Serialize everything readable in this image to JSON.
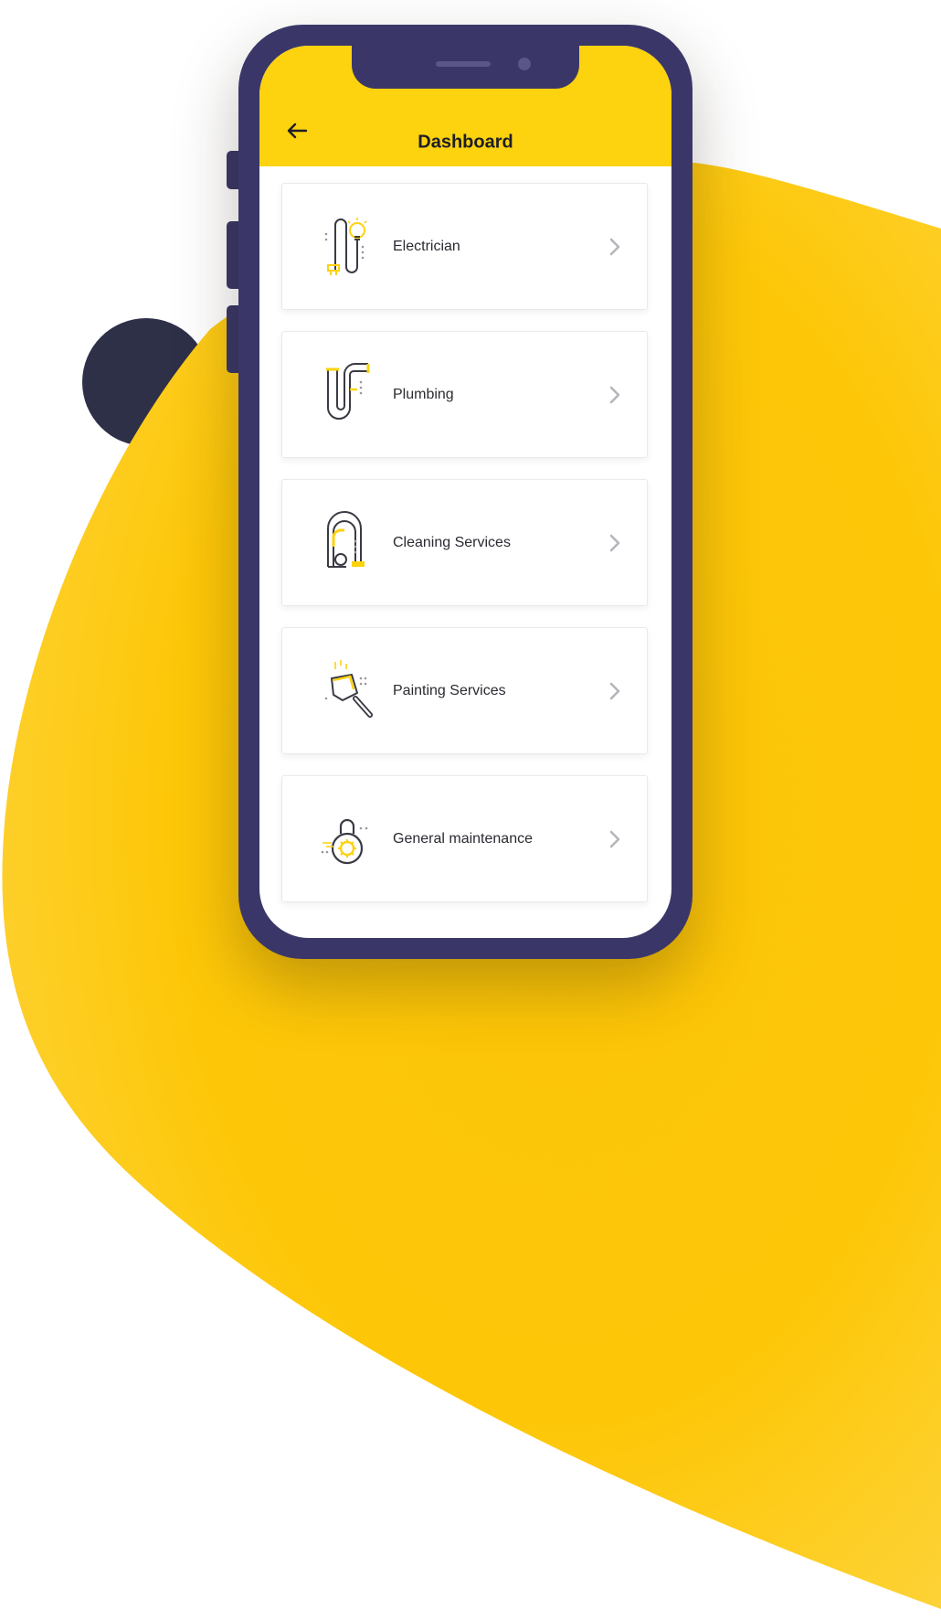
{
  "colors": {
    "accent": "#fdd20e",
    "phone_frame": "#3a3768",
    "dark_blob": "#2d3047",
    "text": "#2a2a32"
  },
  "header": {
    "title": "Dashboard",
    "back_icon": "arrow-left-icon"
  },
  "services": [
    {
      "label": "Electrician",
      "icon": "electrician-icon"
    },
    {
      "label": "Plumbing",
      "icon": "plumbing-icon"
    },
    {
      "label": "Cleaning Services",
      "icon": "vacuum-cleaner-icon"
    },
    {
      "label": "Painting Services",
      "icon": "paint-trowel-icon"
    },
    {
      "label": "General maintenance",
      "icon": "gear-lock-icon"
    }
  ]
}
